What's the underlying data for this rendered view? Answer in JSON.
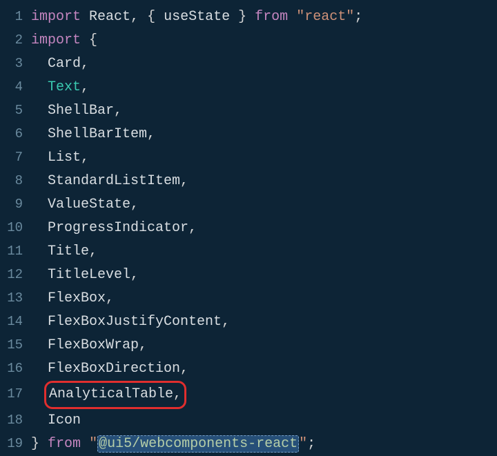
{
  "lines": {
    "1": {
      "num": "1"
    },
    "2": {
      "num": "2"
    },
    "3": {
      "num": "3"
    },
    "4": {
      "num": "4"
    },
    "5": {
      "num": "5"
    },
    "6": {
      "num": "6"
    },
    "7": {
      "num": "7"
    },
    "8": {
      "num": "8"
    },
    "9": {
      "num": "9"
    },
    "10": {
      "num": "10"
    },
    "11": {
      "num": "11"
    },
    "12": {
      "num": "12"
    },
    "13": {
      "num": "13"
    },
    "14": {
      "num": "14"
    },
    "15": {
      "num": "15"
    },
    "16": {
      "num": "16"
    },
    "17": {
      "num": "17"
    },
    "18": {
      "num": "18"
    },
    "19": {
      "num": "19"
    }
  },
  "tokens": {
    "kw_import": "import",
    "react": "React",
    "useState": "useState",
    "k_from": "from",
    "str_react": "\"react\"",
    "brace_open": "{",
    "brace_close": "}",
    "comma": ",",
    "semicolon": ";",
    "sp": " ",
    "indent2": "  ",
    "card": "Card",
    "text": "Text",
    "shellbar": "ShellBar",
    "shellbaritem": "ShellBarItem",
    "list": "List",
    "standardlistitem": "StandardListItem",
    "valuestate": "ValueState",
    "progressindicator": "ProgressIndicator",
    "title": "Title",
    "titlelevel": "TitleLevel",
    "flexbox": "FlexBox",
    "flexboxjustifycontent": "FlexBoxJustifyContent",
    "flexboxwrap": "FlexBoxWrap",
    "flexboxdirection": "FlexBoxDirection",
    "analyticaltable": "AnalyticalTable",
    "icon": "Icon",
    "str_ui5_open_quote": "\"",
    "str_ui5_body": "@ui5/webcomponents-react",
    "str_ui5_close_quote": "\""
  }
}
